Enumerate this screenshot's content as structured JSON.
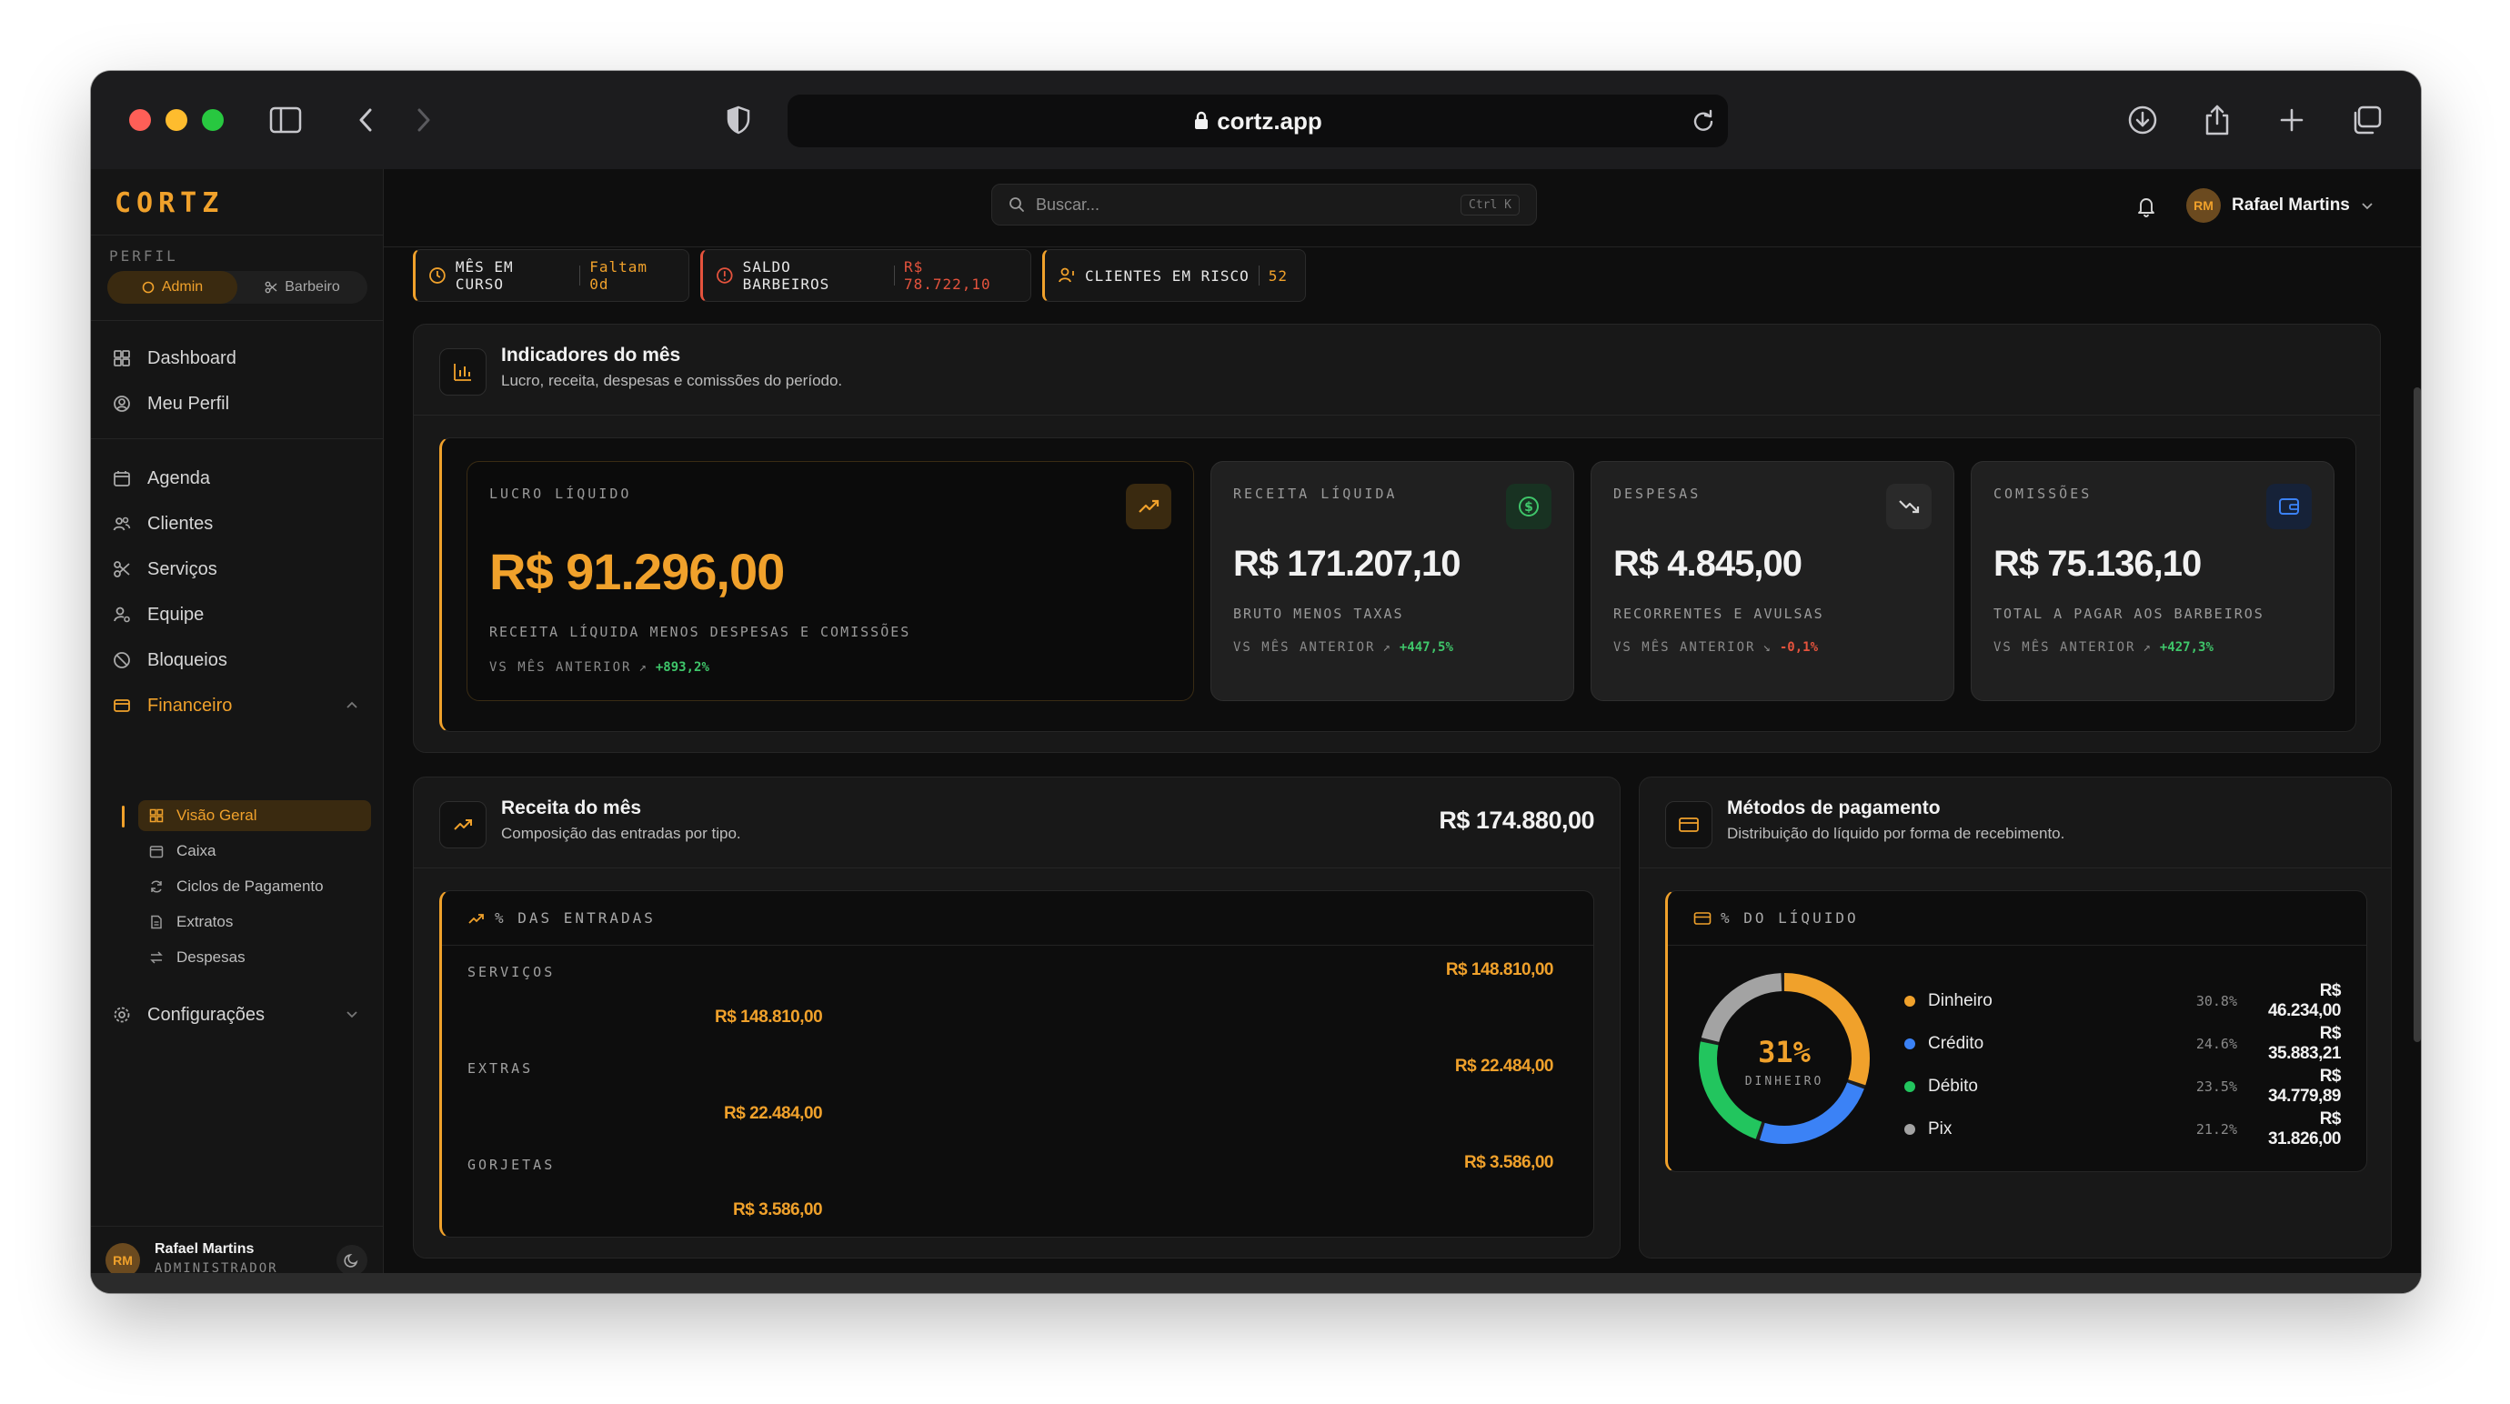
{
  "browser": {
    "url": "cortz.app"
  },
  "sidebar": {
    "logo": "CORTZ",
    "perfil_label": "PERFIL",
    "profile_toggle": {
      "admin": "Admin",
      "barbeiro": "Barbeiro",
      "active": "Admin"
    },
    "nav": [
      {
        "label": "Dashboard",
        "icon": "grid-icon"
      },
      {
        "label": "Meu Perfil",
        "icon": "user-circle-icon"
      },
      {
        "label": "Agenda",
        "icon": "calendar-icon"
      },
      {
        "label": "Clientes",
        "icon": "users-icon"
      },
      {
        "label": "Serviços",
        "icon": "scissors-icon"
      },
      {
        "label": "Equipe",
        "icon": "user-cog-icon"
      },
      {
        "label": "Bloqueios",
        "icon": "ban-icon"
      },
      {
        "label": "Financeiro",
        "icon": "wallet-icon"
      },
      {
        "label": "Configurações",
        "icon": "gear-icon"
      }
    ],
    "financeiro_sub": [
      {
        "label": "Visão Geral",
        "icon": "grid-icon"
      },
      {
        "label": "Caixa",
        "icon": "calendar-icon"
      },
      {
        "label": "Ciclos de Pagamento",
        "icon": "cycle-icon"
      },
      {
        "label": "Extratos",
        "icon": "document-icon"
      },
      {
        "label": "Despesas",
        "icon": "swap-icon"
      }
    ],
    "user": {
      "initials": "RM",
      "name": "Rafael Martins",
      "role": "ADMINISTRADOR"
    }
  },
  "topbar": {
    "search_placeholder": "Buscar...",
    "shortcut": "Ctrl K",
    "user": {
      "initials": "RM",
      "name": "Rafael Martins"
    }
  },
  "chips": [
    {
      "label": "MÊS EM CURSO",
      "value": "Faltam 0d"
    },
    {
      "label": "SALDO BARBEIROS",
      "value": "R$ 78.722,10"
    },
    {
      "label": "CLIENTES EM RISCO",
      "value": "52"
    }
  ],
  "indicators": {
    "title": "Indicadores do mês",
    "subtitle": "Lucro, receita, despesas e comissões do período.",
    "cards": [
      {
        "label": "LUCRO LÍQUIDO",
        "value": "R$ 91.296,00",
        "desc": "RECEITA LÍQUIDA MENOS DESPESAS E COMISSÕES",
        "comp_label": "VS MÊS ANTERIOR",
        "comp_value": "+893,2%",
        "icon": "trending-up-icon"
      },
      {
        "label": "RECEITA LÍQUIDA",
        "value": "R$ 171.207,10",
        "desc": "BRUTO MENOS TAXAS",
        "comp_label": "VS MÊS ANTERIOR",
        "comp_value": "+447,5%",
        "icon": "dollar-circle-icon"
      },
      {
        "label": "DESPESAS",
        "value": "R$ 4.845,00",
        "desc": "RECORRENTES E AVULSAS",
        "comp_label": "VS MÊS ANTERIOR",
        "comp_value": "-0,1%",
        "icon": "trending-down-icon"
      },
      {
        "label": "COMISSÕES",
        "value": "R$ 75.136,10",
        "desc": "TOTAL A PAGAR AOS BARBEIROS",
        "comp_label": "VS MÊS ANTERIOR",
        "comp_value": "+427,3%",
        "icon": "wallet-icon"
      }
    ]
  },
  "revenue": {
    "title": "Receita do mês",
    "subtitle": "Composição das entradas por tipo.",
    "total": "R$ 174.880,00",
    "section_label": "% DAS ENTRADAS",
    "rows": [
      {
        "label": "SERVIÇOS",
        "value": "R$ 148.810,00"
      },
      {
        "label": "EXTRAS",
        "value": "R$ 22.484,00"
      },
      {
        "label": "GORJETAS",
        "value": "R$ 3.586,00"
      }
    ]
  },
  "payments": {
    "title": "Métodos de pagamento",
    "subtitle": "Distribuição do líquido por forma de recebimento.",
    "section_label": "% DO LÍQUIDO",
    "donut_center_value": "31%",
    "donut_center_label": "DINHEIRO",
    "methods": [
      {
        "name": "Dinheiro",
        "pct": "30.8%",
        "value": "R$ 46.234,00",
        "color": "#f0a12b"
      },
      {
        "name": "Crédito",
        "pct": "24.6%",
        "value": "R$ 35.883,21",
        "color": "#3b82f6"
      },
      {
        "name": "Débito",
        "pct": "23.5%",
        "value": "R$ 34.779,89",
        "color": "#22c55e"
      },
      {
        "name": "Pix",
        "pct": "21.2%",
        "value": "R$ 31.826,00",
        "color": "#a3a3a3"
      }
    ]
  },
  "colors": {
    "accent": "#f0a12b",
    "positive": "#3fc66a",
    "negative": "#e5533d"
  }
}
